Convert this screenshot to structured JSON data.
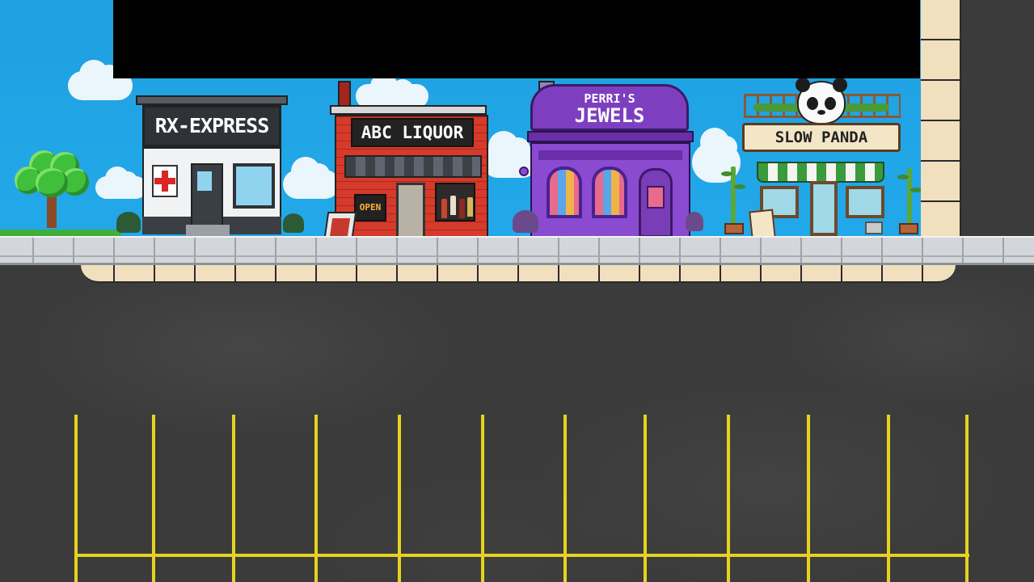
{
  "scene": {
    "stores": [
      {
        "id": "rx",
        "sign": "RX-EXPRESS"
      },
      {
        "id": "abc",
        "sign": "ABC LIQUOR",
        "door_sign": "OPEN"
      },
      {
        "id": "pj",
        "sign_line1": "PERRI'S",
        "sign_line2": "JEWELS"
      },
      {
        "id": "sp",
        "sign": "SLOW PANDA"
      }
    ],
    "parking_spaces": 11
  },
  "colors": {
    "sky": "#22a9ea",
    "asphalt": "#3b3b3b",
    "parking_line": "#e6d21f",
    "curb_tile": "#f1dfbd",
    "overlay_bar": "#000000"
  }
}
